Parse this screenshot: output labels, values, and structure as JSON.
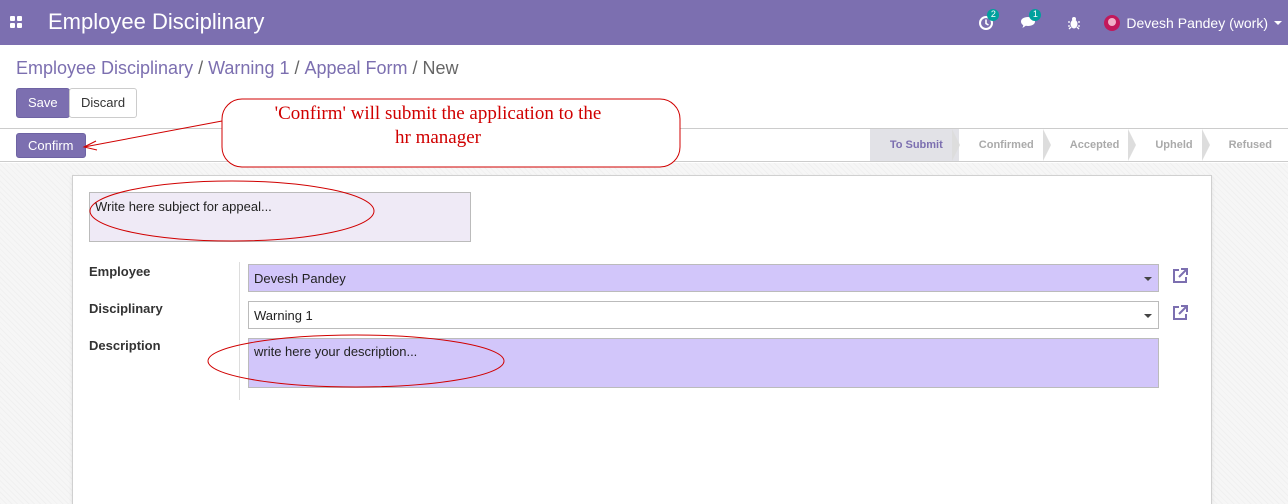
{
  "navbar": {
    "app_title": "Employee Disciplinary",
    "activity_badge": "2",
    "message_badge": "1",
    "user_name": "Devesh Pandey (work)"
  },
  "breadcrumb": {
    "items": [
      "Employee Disciplinary",
      "Warning 1",
      "Appeal Form"
    ],
    "current": "New",
    "separator": "/"
  },
  "buttons": {
    "save": "Save",
    "discard": "Discard",
    "confirm": "Confirm"
  },
  "statusbar": {
    "stages": [
      "To Submit",
      "Confirmed",
      "Accepted",
      "Upheld",
      "Refused"
    ],
    "current_stage": "To Submit"
  },
  "form": {
    "subject_placeholder": "Write here subject for appeal...",
    "employee_label": "Employee",
    "employee_value": "Devesh Pandey",
    "disciplinary_label": "Disciplinary",
    "disciplinary_value": "Warning 1",
    "description_label": "Description",
    "description_placeholder": "write here your description..."
  },
  "annotation": {
    "line1": "'Confirm' will submit the application to the",
    "line2": "hr manager"
  },
  "colors": {
    "brand": "#7c6fb0",
    "required_field": "#d2c6fa",
    "annotation": "#d00000",
    "badge": "#00a09d"
  }
}
